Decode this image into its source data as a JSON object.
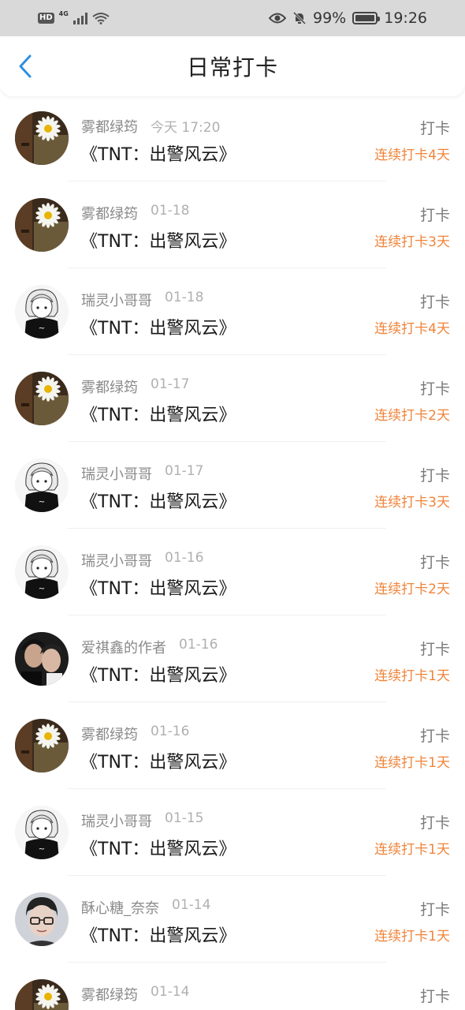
{
  "status_bar": {
    "hd": "HD",
    "network": "4G",
    "battery": "99%",
    "battery_level": 0.99,
    "time": "19:26"
  },
  "header": {
    "title": "日常打卡"
  },
  "entries": [
    {
      "user": "雾都绿筠",
      "time": "今天 17:20",
      "book": "《TNT：出警风云》",
      "action": "打卡",
      "streak": "连续打卡4天",
      "avatar": "daisy"
    },
    {
      "user": "雾都绿筠",
      "time": "01-18",
      "book": "《TNT：出警风云》",
      "action": "打卡",
      "streak": "连续打卡3天",
      "avatar": "daisy"
    },
    {
      "user": "瑞灵小哥哥",
      "time": "01-18",
      "book": "《TNT：出警风云》",
      "action": "打卡",
      "streak": "连续打卡4天",
      "avatar": "anime"
    },
    {
      "user": "雾都绿筠",
      "time": "01-17",
      "book": "《TNT：出警风云》",
      "action": "打卡",
      "streak": "连续打卡2天",
      "avatar": "daisy"
    },
    {
      "user": "瑞灵小哥哥",
      "time": "01-17",
      "book": "《TNT：出警风云》",
      "action": "打卡",
      "streak": "连续打卡3天",
      "avatar": "anime"
    },
    {
      "user": "瑞灵小哥哥",
      "time": "01-16",
      "book": "《TNT：出警风云》",
      "action": "打卡",
      "streak": "连续打卡2天",
      "avatar": "anime"
    },
    {
      "user": "爱祺鑫的作者",
      "time": "01-16",
      "book": "《TNT：出警风云》",
      "action": "打卡",
      "streak": "连续打卡1天",
      "avatar": "photo"
    },
    {
      "user": "雾都绿筠",
      "time": "01-16",
      "book": "《TNT：出警风云》",
      "action": "打卡",
      "streak": "连续打卡1天",
      "avatar": "daisy"
    },
    {
      "user": "瑞灵小哥哥",
      "time": "01-15",
      "book": "《TNT：出警风云》",
      "action": "打卡",
      "streak": "连续打卡1天",
      "avatar": "anime"
    },
    {
      "user": "酥心糖_奈奈",
      "time": "01-14",
      "book": "《TNT：出警风云》",
      "action": "打卡",
      "streak": "连续打卡1天",
      "avatar": "glasses"
    },
    {
      "user": "雾都绿筠",
      "time": "01-14",
      "book": "",
      "action": "打卡",
      "streak": "",
      "avatar": "daisy"
    }
  ],
  "colors": {
    "accent": "#2f8fe0",
    "streak": "#f0843a",
    "status_bar_bg": "#d9d9d9"
  }
}
